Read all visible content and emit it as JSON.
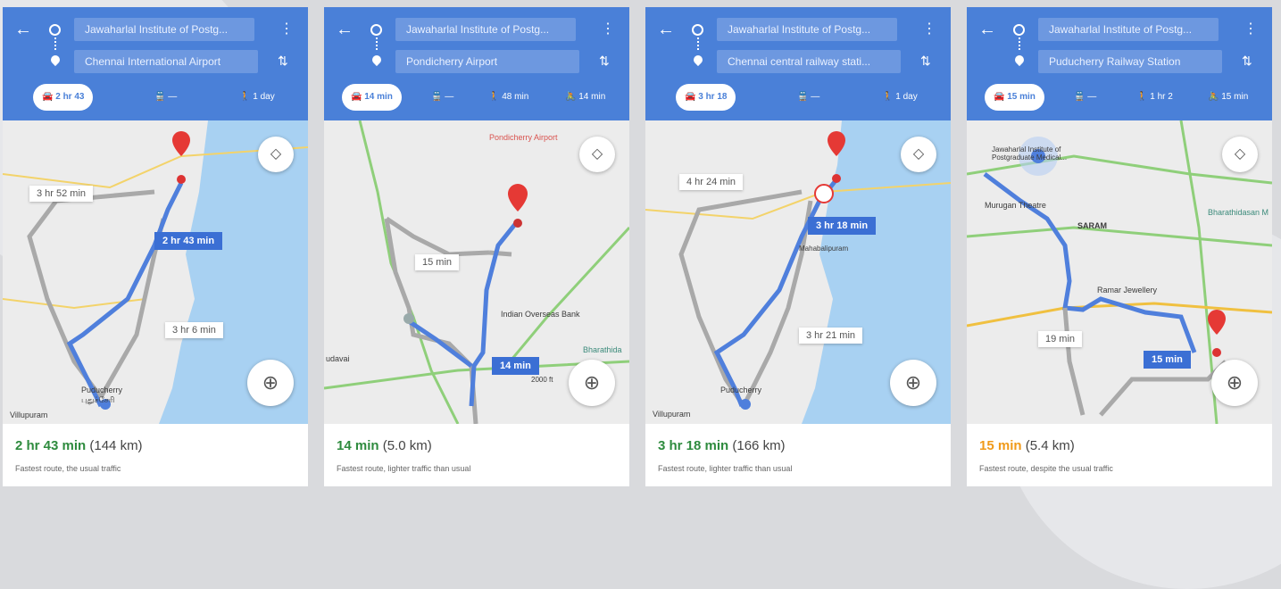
{
  "panels": [
    {
      "origin": "Jawaharlal Institute of Postg...",
      "destination": "Chennai International Airport",
      "modes": {
        "drive": "2 hr 43",
        "transit": "—",
        "walk": "1 day",
        "ride": ""
      },
      "labels": {
        "selected": "2 hr 43 min",
        "alt1": "3 hr 52 min",
        "alt2": "3 hr 6 min"
      },
      "places": {
        "p1": "Puducherry",
        "p2": "புதுச்சேரி",
        "p3": "Villupuram"
      },
      "summary": {
        "time": "2 hr 43 min",
        "distance": "(144 km)",
        "desc": "Fastest route, the usual traffic"
      }
    },
    {
      "origin": "Jawaharlal Institute of Postg...",
      "destination": "Pondicherry Airport",
      "modes": {
        "drive": "14 min",
        "transit": "—",
        "walk": "48 min",
        "ride": "14 min"
      },
      "labels": {
        "selected": "14 min",
        "alt1": "15 min",
        "alt2": ""
      },
      "places": {
        "p1": "Pondicherry Airport",
        "p2": "Indian Overseas Bank",
        "p3": "Bharathida",
        "p4": "udavai",
        "p5": "2000 ft"
      },
      "summary": {
        "time": "14 min",
        "distance": "(5.0 km)",
        "desc": "Fastest route, lighter traffic than usual"
      }
    },
    {
      "origin": "Jawaharlal Institute of Postg...",
      "destination": "Chennai central railway stati...",
      "modes": {
        "drive": "3 hr 18",
        "transit": "—",
        "walk": "1 day",
        "ride": ""
      },
      "labels": {
        "selected": "3 hr 18 min",
        "alt1": "4 hr 24 min",
        "alt2": "3 hr 21 min"
      },
      "places": {
        "p1": "Puducherry",
        "p2": "Villupuram",
        "p3": "Mahabalipuram"
      },
      "summary": {
        "time": "3 hr 18 min",
        "distance": "(166 km)",
        "desc": "Fastest route, lighter traffic than usual"
      }
    },
    {
      "origin": "Jawaharlal Institute of Postg...",
      "destination": "Puducherry Railway Station",
      "modes": {
        "drive": "15 min",
        "transit": "—",
        "walk": "1 hr 2",
        "ride": "15 min"
      },
      "labels": {
        "selected": "15 min",
        "alt1": "19 min",
        "alt2": ""
      },
      "places": {
        "p1": "Jawaharlal Institute of Postgraduate Medical...",
        "p2": "Murugan Theatre",
        "p3": "SARAM",
        "p4": "Ramar Jewellery",
        "p5": "Bharathidasan M"
      },
      "summary": {
        "time": "15 min",
        "distance": "(5.4 km)",
        "desc": "Fastest route, despite the usual traffic"
      }
    }
  ],
  "colors": {
    "header": "#4a80d8",
    "route": "#4f7fdc",
    "alt_route": "#a9a9a9",
    "sea": "#a8d1f2",
    "land": "#ececec",
    "green_time": "#2e8b3e",
    "orange_time": "#f09a1a"
  },
  "icons": {
    "back": "arrow-left-icon",
    "menu": "more-vert-icon",
    "swap": "swap-icon",
    "car": "car-icon",
    "transit": "train-icon",
    "walk": "walk-icon",
    "ride": "ride-icon",
    "layers": "layers-icon",
    "locate": "my-location-icon",
    "pin": "pin-icon"
  }
}
